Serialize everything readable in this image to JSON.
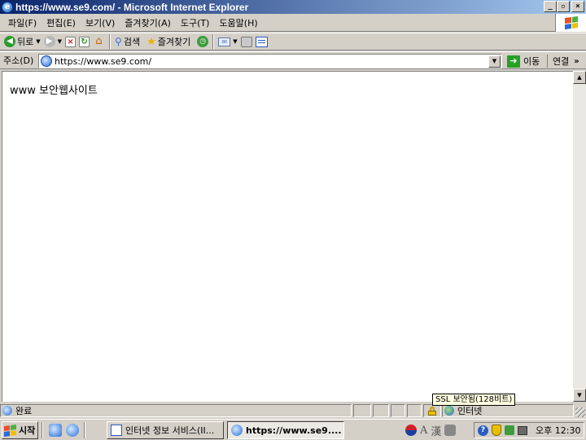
{
  "window": {
    "title": "https://www.se9.com/ - Microsoft Internet Explorer",
    "min_glyph": "_",
    "max_glyph": "▫",
    "close_glyph": "×"
  },
  "menu": {
    "items": [
      "파일(F)",
      "편집(E)",
      "보기(V)",
      "즐겨찾기(A)",
      "도구(T)",
      "도움말(H)"
    ]
  },
  "toolbar": {
    "back_label": "뒤로",
    "search_label": "검색",
    "favorites_label": "즐겨찾기"
  },
  "address": {
    "label": "주소(D)",
    "url": "https://www.se9.com/",
    "go_label": "이동",
    "links_label": "연결",
    "more_glyph": "»"
  },
  "page": {
    "body_text": "www 보안웹사이트"
  },
  "status": {
    "text": "완료",
    "tooltip": "SSL 보안됨(128비트)",
    "zone": "인터넷"
  },
  "taskbar": {
    "start_label": "시작",
    "tasks": [
      {
        "label": "인터넷 정보 서비스(II...",
        "active": false
      },
      {
        "label": "https://www.se9....",
        "active": true
      }
    ],
    "ime_a": "A",
    "ime_han": "漢",
    "clock": "오후 12:30"
  },
  "icons": {
    "back": "back-arrow-icon",
    "forward": "forward-arrow-icon",
    "stop": "stop-icon",
    "refresh": "refresh-icon",
    "home": "home-icon",
    "search": "search-icon",
    "favorites": "star-icon",
    "history": "history-icon",
    "mail": "mail-icon",
    "print": "print-icon",
    "edit": "edit-icon",
    "lock": "lock-icon",
    "globe": "internet-zone-icon"
  },
  "colors": {
    "titlebar_start": "#0a246a",
    "titlebar_end": "#a6caf0",
    "chrome": "#d4d0c8",
    "tooltip_bg": "#ffffe1"
  }
}
